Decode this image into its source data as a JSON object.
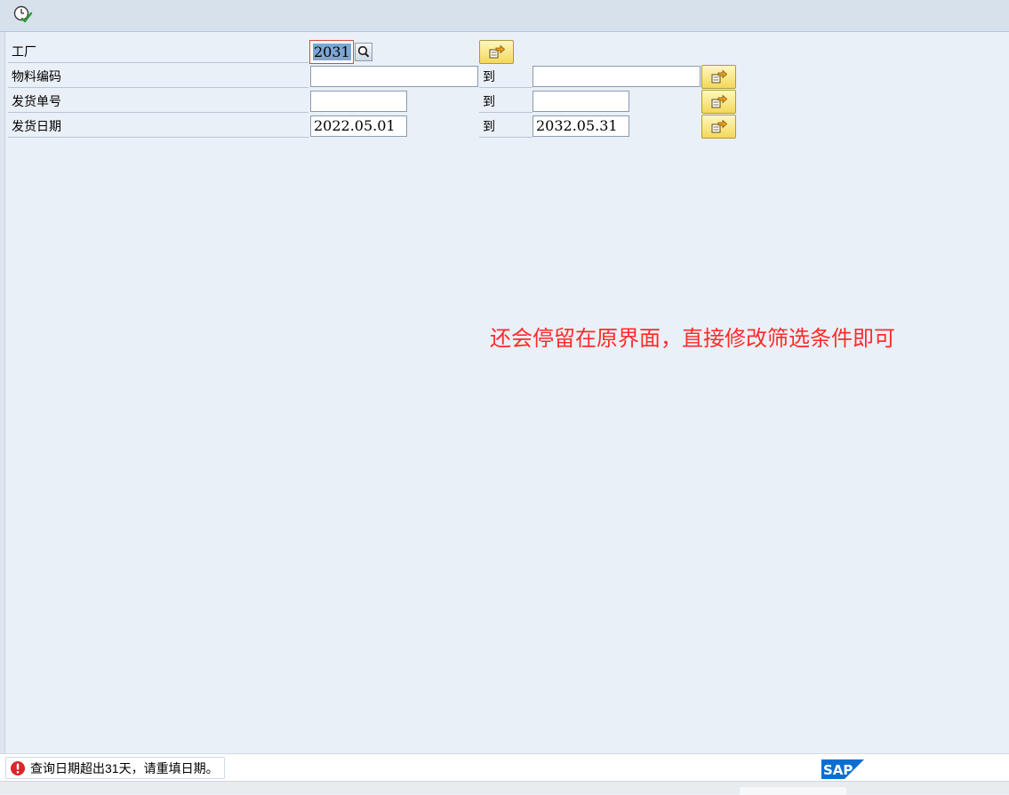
{
  "toolbar": {
    "execute_icon": "execute-clock-check-icon"
  },
  "selection": {
    "to_label": "到",
    "rows": [
      {
        "label": "工厂",
        "low": "2031"
      },
      {
        "label": "物料编码",
        "low": "",
        "high": ""
      },
      {
        "label": "发货单号",
        "low": "",
        "high": ""
      },
      {
        "label": "发货日期",
        "low": "2022.05.01",
        "high": "2032.05.31"
      }
    ]
  },
  "annotation": {
    "text": "还会停留在原界面，直接修改筛选条件即可",
    "color": "#ff2b2b"
  },
  "status": {
    "type": "error",
    "message": "查询日期超出31天，请重填日期。",
    "icon": "error-exclamation-icon"
  },
  "branding": {
    "logo_text": "SAP"
  },
  "colors": {
    "background": "#eaf0f7",
    "toolbar": "#d6e1ec",
    "selection_highlight": "#7ea6d3",
    "error": "#d9262b",
    "sap_blue": "#0a6ed1"
  }
}
